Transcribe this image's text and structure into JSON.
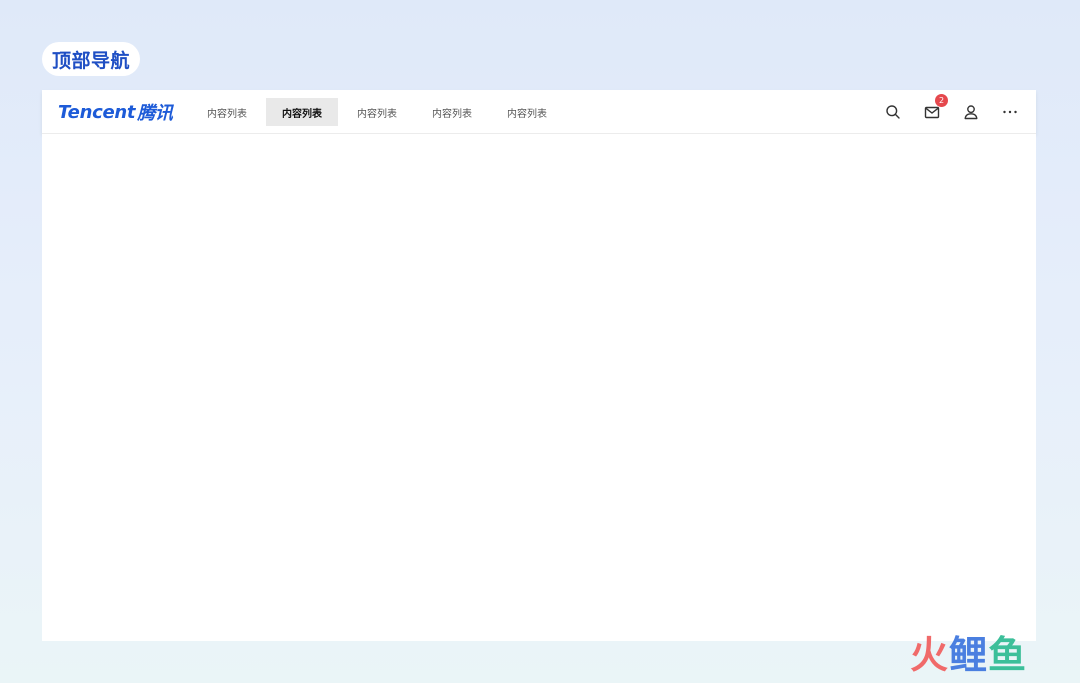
{
  "section_label": "顶部导航",
  "logo": {
    "latin": "Tencent",
    "cn": "腾讯"
  },
  "nav": {
    "tabs": [
      {
        "label": "内容列表",
        "active": false
      },
      {
        "label": "内容列表",
        "active": true
      },
      {
        "label": "内容列表",
        "active": false
      },
      {
        "label": "内容列表",
        "active": false
      },
      {
        "label": "内容列表",
        "active": false
      }
    ]
  },
  "actions": {
    "search_icon": "search-icon",
    "mail_icon": "mail-icon",
    "mail_badge_count": "2",
    "user_icon": "user-icon",
    "more_icon": "more-icon"
  },
  "watermark": {
    "chars": [
      "火",
      "鲤",
      "鱼"
    ]
  },
  "colors": {
    "brand": "#1d5bd8",
    "label_text": "#1f4fc4",
    "badge": "#e5484d",
    "active_tab_bg": "#e9e9e9"
  }
}
